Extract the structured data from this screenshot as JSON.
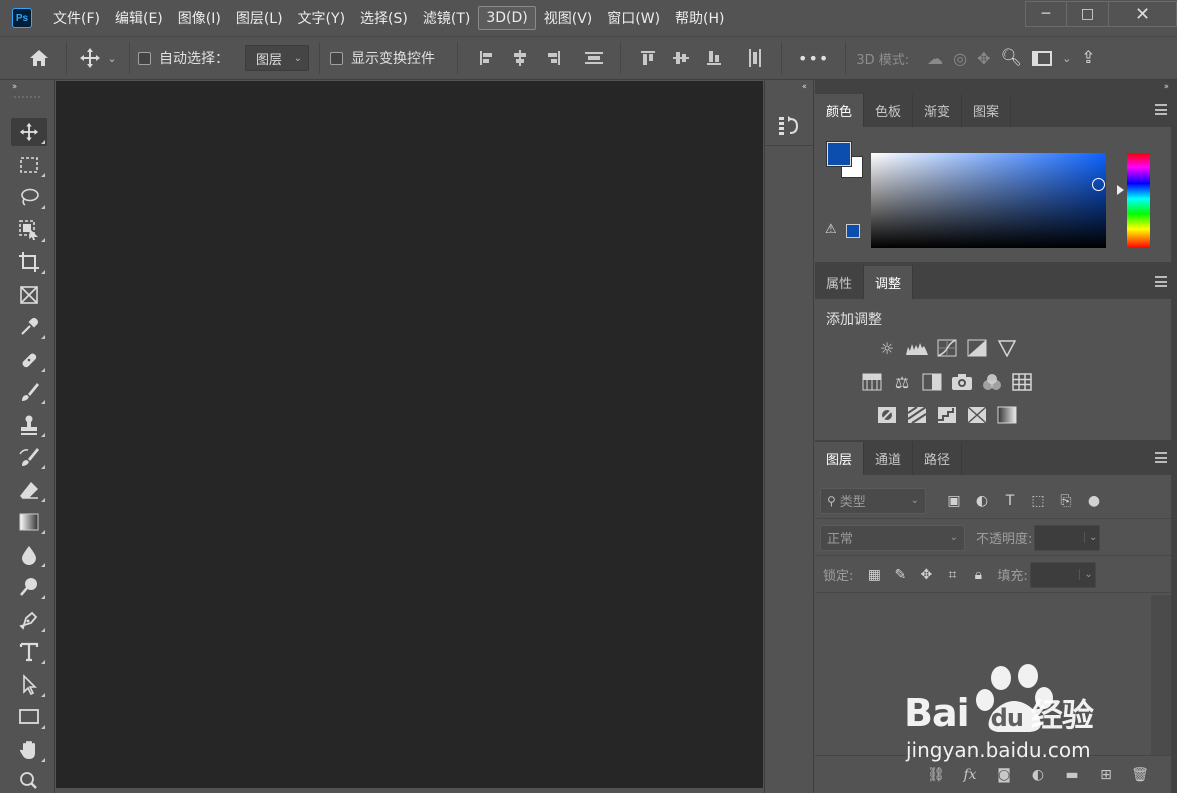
{
  "app": {
    "logo_text": "Ps"
  },
  "menu": [
    "文件(F)",
    "编辑(E)",
    "图像(I)",
    "图层(L)",
    "文字(Y)",
    "选择(S)",
    "滤镜(T)",
    "3D(D)",
    "视图(V)",
    "窗口(W)",
    "帮助(H)"
  ],
  "window_controls": {
    "minimize": "─",
    "maximize": "□",
    "close": "✕"
  },
  "options": {
    "home_icon": "home-icon",
    "move_icon": "move-icon",
    "auto_select_label": "自动选择：",
    "auto_select_value": "图层",
    "show_transform_label": "显示变换控件",
    "more": "•••",
    "mode_label": "3D 模式:"
  },
  "collapse_glyph": "››",
  "collapse_glyph_left": "‹‹",
  "color_panel": {
    "tabs": [
      "颜色",
      "色板",
      "渐变",
      "图案"
    ],
    "active_tab": "颜色",
    "foreground": "#0b4ead",
    "background": "#ffffff"
  },
  "adjust_panel": {
    "tabs": [
      "属性",
      "调整"
    ],
    "active_tab": "调整",
    "title": "添加调整"
  },
  "layers_panel": {
    "tabs": [
      "图层",
      "通道",
      "路径"
    ],
    "active_tab": "图层",
    "filter_placeholder": "类型",
    "blend_mode": "正常",
    "opacity_label": "不透明度:",
    "lock_label": "锁定:",
    "fill_label": "填充:"
  },
  "watermark": {
    "brand": "Bai",
    "brand2": "du",
    "suffix": "经验",
    "url": "jingyan.baidu.com"
  }
}
